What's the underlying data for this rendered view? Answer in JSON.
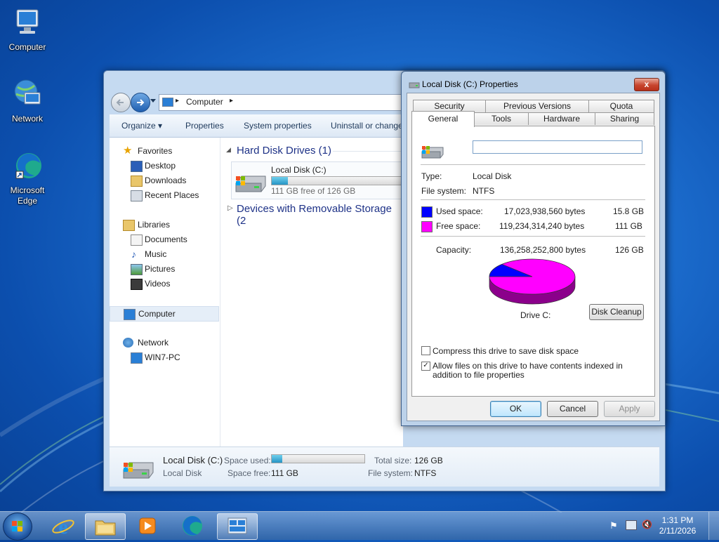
{
  "desktop": {
    "icons": [
      {
        "label": "Computer"
      },
      {
        "label": "Network"
      },
      {
        "label": "Microsoft Edge"
      }
    ]
  },
  "explorer": {
    "breadcrumb": [
      "Computer"
    ],
    "toolbar": {
      "organize": "Organize ▾",
      "properties": "Properties",
      "system_properties": "System properties",
      "uninstall": "Uninstall or change"
    },
    "nav": {
      "favorites": "Favorites",
      "desktop": "Desktop",
      "downloads": "Downloads",
      "recent": "Recent Places",
      "libraries": "Libraries",
      "documents": "Documents",
      "music": "Music",
      "pictures": "Pictures",
      "videos": "Videos",
      "computer": "Computer",
      "network": "Network",
      "pc": "WIN7-PC"
    },
    "groups": {
      "hdd": "Hard Disk Drives (1)",
      "removable": "Devices with Removable Storage (2"
    },
    "drive": {
      "name": "Local Disk (C:)",
      "free_text": "111 GB free of 126 GB",
      "used_fraction": 0.116
    },
    "details": {
      "name": "Local Disk (C:)",
      "type": "Local Disk",
      "space_used_label": "Space used:",
      "space_free_label": "Space free:",
      "space_free": "111 GB",
      "total_size_label": "Total size:",
      "total_size": "126 GB",
      "file_system_label": "File system:",
      "file_system": "NTFS"
    }
  },
  "dialog": {
    "title": "Local Disk (C:) Properties",
    "close": "x",
    "tabs_row1": [
      "Security",
      "Previous Versions",
      "Quota"
    ],
    "tabs_row2": [
      "General",
      "Tools",
      "Hardware",
      "Sharing"
    ],
    "volume_label_value": "",
    "type_label": "Type:",
    "type_value": "Local Disk",
    "fs_label": "File system:",
    "fs_value": "NTFS",
    "used_label": "Used space:",
    "used_bytes": "17,023,938,560 bytes",
    "used_gb": "15.8 GB",
    "free_label": "Free space:",
    "free_bytes": "119,234,314,240 bytes",
    "free_gb": "111 GB",
    "capacity_label": "Capacity:",
    "capacity_bytes": "136,258,252,800 bytes",
    "capacity_gb": "126 GB",
    "drive_label": "Drive C:",
    "disk_cleanup": "Disk Cleanup",
    "compress_label": "Compress this drive to save disk space",
    "compress_checked": false,
    "index_label": "Allow files on this drive to have contents indexed in addition to file properties",
    "index_checked": true,
    "ok": "OK",
    "cancel": "Cancel",
    "apply": "Apply",
    "colors": {
      "used": "#0000ff",
      "free": "#ff00ff"
    },
    "used_fraction": 0.125
  },
  "taskbar": {
    "time": "1:31 PM",
    "date": "2/11/2026"
  }
}
